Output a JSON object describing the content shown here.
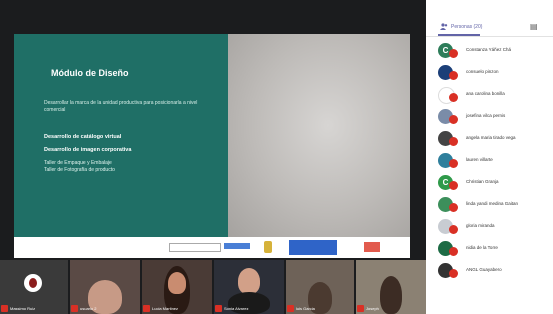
{
  "slide": {
    "title": "Módulo de Diseño",
    "subtitle": "Desarrollar la marca de la unidad productiva para posicionarla a nivel comercial",
    "bullets": [
      "Desarrollo de catálogo virtual",
      "Desarrollo de imagen corporativa",
      "Taller de Empaque y Embalaje",
      "Taller de Fotografía de producto"
    ]
  },
  "sidebar": {
    "tab_people_label": "Personas (20)",
    "participants": [
      {
        "initial": "C",
        "color": "#2e7d5a",
        "name": "Constanza Yáñez Chá"
      },
      {
        "initial": "",
        "color": "#1c3f78",
        "name": "consuelo pinzon"
      },
      {
        "initial": "",
        "color": "#ffffff",
        "name": "ana carolina bonilla"
      },
      {
        "initial": "",
        "color": "#7a8ca8",
        "name": "josefina vilca pernis"
      },
      {
        "initial": "",
        "color": "#444444",
        "name": "angela maria tirado vega"
      },
      {
        "initial": "",
        "color": "#2f7f9c",
        "name": "lauren villarte"
      },
      {
        "initial": "C",
        "color": "#2f9a4a",
        "name": "Christian Granja"
      },
      {
        "initial": "",
        "color": "#3c8f5b",
        "name": "linda yandi medina Gaitan"
      },
      {
        "initial": "",
        "color": "#c8ccd2",
        "name": "gloria miranda"
      },
      {
        "initial": "",
        "color": "#1d6b45",
        "name": "nidia de la Torre"
      },
      {
        "initial": "",
        "color": "#333333",
        "name": "ANGL Guayabero"
      }
    ]
  },
  "tiles": [
    {
      "name": "Massimo Ruiz",
      "bg": "#3a3a3a"
    },
    {
      "name": "usuario 2",
      "bg": "#5a4a45"
    },
    {
      "name": "Lucia Martinez",
      "bg": "#4a3b36"
    },
    {
      "name": "Sonia Alvarez",
      "bg": "#2c2f38"
    },
    {
      "name": "luis Garcia",
      "bg": "#6e6258"
    },
    {
      "name": "Joseph",
      "bg": "#8b8173"
    }
  ]
}
